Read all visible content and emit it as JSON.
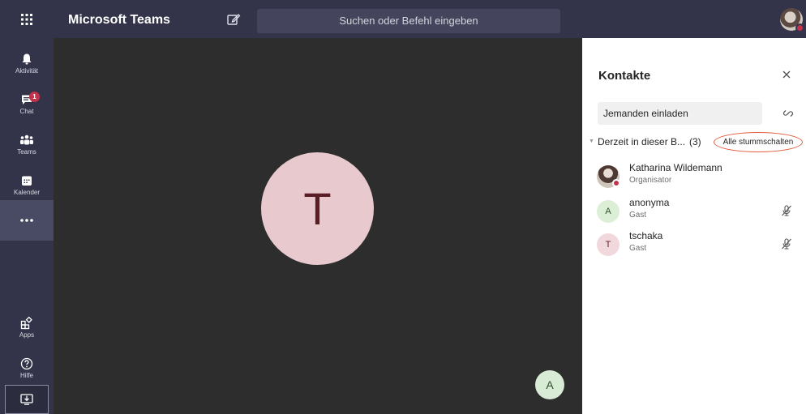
{
  "app": {
    "title": "Microsoft Teams"
  },
  "search": {
    "placeholder": "Suchen oder Befehl eingeben"
  },
  "rail": {
    "items": [
      {
        "label": "Aktivität",
        "icon": "bell-icon"
      },
      {
        "label": "Chat",
        "icon": "chat-icon",
        "badge": "1"
      },
      {
        "label": "Teams",
        "icon": "teams-icon"
      },
      {
        "label": "Kalender",
        "icon": "calendar-icon"
      },
      {
        "label": "…",
        "icon": "more-icon"
      },
      {
        "label": "Apps",
        "icon": "apps-icon"
      },
      {
        "label": "Hilfe",
        "icon": "help-icon"
      }
    ]
  },
  "stage": {
    "main_initial": "T",
    "small_initial": "A"
  },
  "panel": {
    "title": "Kontakte",
    "invite_placeholder": "Jemanden einladen",
    "section_label": "Derzeit in dieser B...",
    "section_count": "(3)",
    "mute_all_label": "Alle stummschalten",
    "participants": [
      {
        "name": "Katharina Wildemann",
        "role": "Organisator",
        "initial": ""
      },
      {
        "name": "anonyma",
        "role": "Gast",
        "initial": "A"
      },
      {
        "name": "tschaka",
        "role": "Gast",
        "initial": "T"
      }
    ]
  },
  "colors": {
    "rail_bg": "#33344a",
    "stage_bg": "#2d2d2d",
    "alert_red": "#c4314b",
    "annotation_circle": "#e05a3c"
  }
}
